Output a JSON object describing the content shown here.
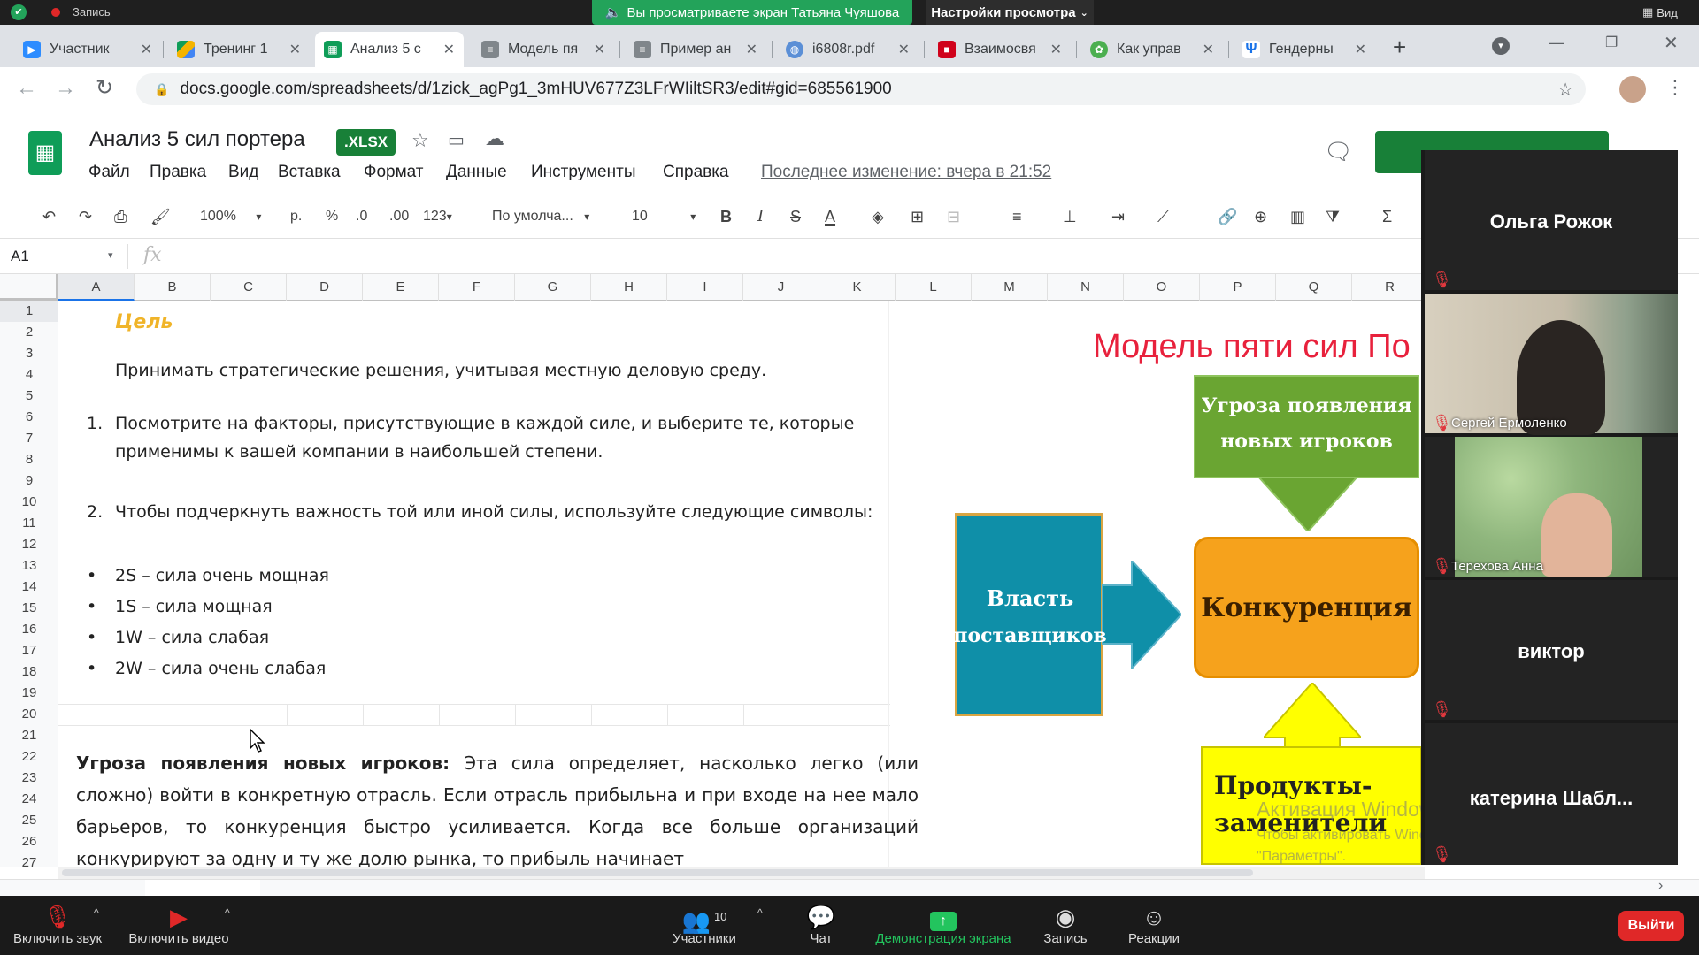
{
  "zoom_top": {
    "recording_label": "Запись",
    "share_banner": "Вы просматриваете экран Татьяна Чуяшова",
    "view_settings": "Настройки просмотра",
    "view_label": "Вид"
  },
  "browser": {
    "tabs": [
      {
        "label": "Участник",
        "icon": "zoom-icon",
        "color": "#2d8cff"
      },
      {
        "label": "Тренинг 1",
        "icon": "drive-icon",
        "color": "#f4b400"
      },
      {
        "label": "Анализ 5 с",
        "icon": "sheets-icon",
        "color": "#0f9d58"
      },
      {
        "label": "Модель пя",
        "icon": "doc-icon",
        "color": "#5f6368"
      },
      {
        "label": "Пример ан",
        "icon": "doc-icon",
        "color": "#5f6368"
      },
      {
        "label": "i6808r.pdf",
        "icon": "globe-icon",
        "color": "#5b8fd6"
      },
      {
        "label": "Взаимосвя",
        "icon": "red-logo-icon",
        "color": "#d0021b"
      },
      {
        "label": "Как управ",
        "icon": "clover-icon",
        "color": "#4caf50"
      },
      {
        "label": "Гендерны",
        "icon": "psi-icon",
        "color": "#1a73e8"
      }
    ],
    "url": "docs.google.com/spreadsheets/d/1zick_agPg1_3mHUV677Z3LFrWIiltSR3/edit#gid=685561900"
  },
  "sheets": {
    "title": "Анализ 5 сил портера",
    "badge": ".XLSX",
    "menu": [
      "Файл",
      "Правка",
      "Вид",
      "Вставка",
      "Формат",
      "Данные",
      "Инструменты",
      "Справка"
    ],
    "last_edit": "Последнее изменение: вчера в 21:52",
    "toolbar": {
      "zoom": "100%",
      "currency": "р.",
      "percent": "%",
      "dec_less": ".0",
      "dec_more": ".00",
      "format_more": "123",
      "font": "По умолча...",
      "font_size": "10"
    },
    "cell_ref": "A1",
    "fx": "fx",
    "columns": [
      "A",
      "B",
      "C",
      "D",
      "E",
      "F",
      "G",
      "H",
      "I",
      "J",
      "K",
      "L",
      "M",
      "N",
      "O",
      "P",
      "Q",
      "R"
    ],
    "rows": [
      "1",
      "2",
      "3",
      "4",
      "5",
      "6",
      "7",
      "8",
      "9",
      "10",
      "11",
      "12",
      "13",
      "14",
      "15",
      "16",
      "17",
      "18",
      "19",
      "20",
      "21",
      "22",
      "23",
      "24",
      "25",
      "26",
      "27"
    ]
  },
  "content": {
    "goal_heading": "Цель",
    "goal_text": "Принимать стратегические решения, учитывая местную деловую среду.",
    "step1_num": "1.",
    "step1_line1": "Посмотрите на факторы, присутствующие в каждой силе, и выберите те, которые",
    "step1_line2": "применимы к вашей компании в наибольшей степени.",
    "step2_num": "2.",
    "step2_text": "Чтобы подчеркнуть важность той или иной силы, используйте следующие символы:",
    "bullets": [
      "2S – сила очень мощная",
      "1S – сила мощная",
      "1W – сила слабая",
      "2W – сила очень слабая"
    ],
    "para_bold": "Угроза появления новых игроков:",
    "para_text": "Эта сила определяет, насколько легко (или сложно) войти в конкретную отрасль. Если отрасль прибыльна и при входе на нее мало барьеров, то конкуренция быстро усиливается. Когда все больше организаций конкурируют за одну и ту же долю рынка, то прибыль начинает"
  },
  "diagram": {
    "title": "Модель пяти сил По",
    "new_entrants_line1": "Угроза появления",
    "new_entrants_line2": "новых игроков",
    "suppliers_line1": "Власть",
    "suppliers_line2": "поставщиков",
    "rivalry": "Конкуренция",
    "substitutes_line1": "Продукты-",
    "substitutes_line2": "заменители",
    "colors": {
      "green": "#6aa532",
      "teal": "#0f8fa8",
      "orange": "#f6a21c",
      "yellow": "#ffff00",
      "title": "#e8213c"
    }
  },
  "watermark": {
    "title": "Активация Windows",
    "line1": "Чтобы активировать Windows, перейдите в раздел",
    "line2": "\"Параметры\"."
  },
  "participants": [
    {
      "name": "Ольга Рожок",
      "type": "name"
    },
    {
      "name": "Сергей Ермоленко",
      "type": "video"
    },
    {
      "name": "Терехова Анна",
      "type": "video"
    },
    {
      "name": "виктор",
      "type": "name"
    },
    {
      "name": "катерина Шабл...",
      "type": "name"
    }
  ],
  "zoom_bottom": {
    "unmute": "Включить звук",
    "start_video": "Включить видео",
    "participants": "Участники",
    "participants_count": "10",
    "chat": "Чат",
    "share": "Демонстрация экрана",
    "record": "Запись",
    "reactions": "Реакции",
    "leave": "Выйти"
  }
}
